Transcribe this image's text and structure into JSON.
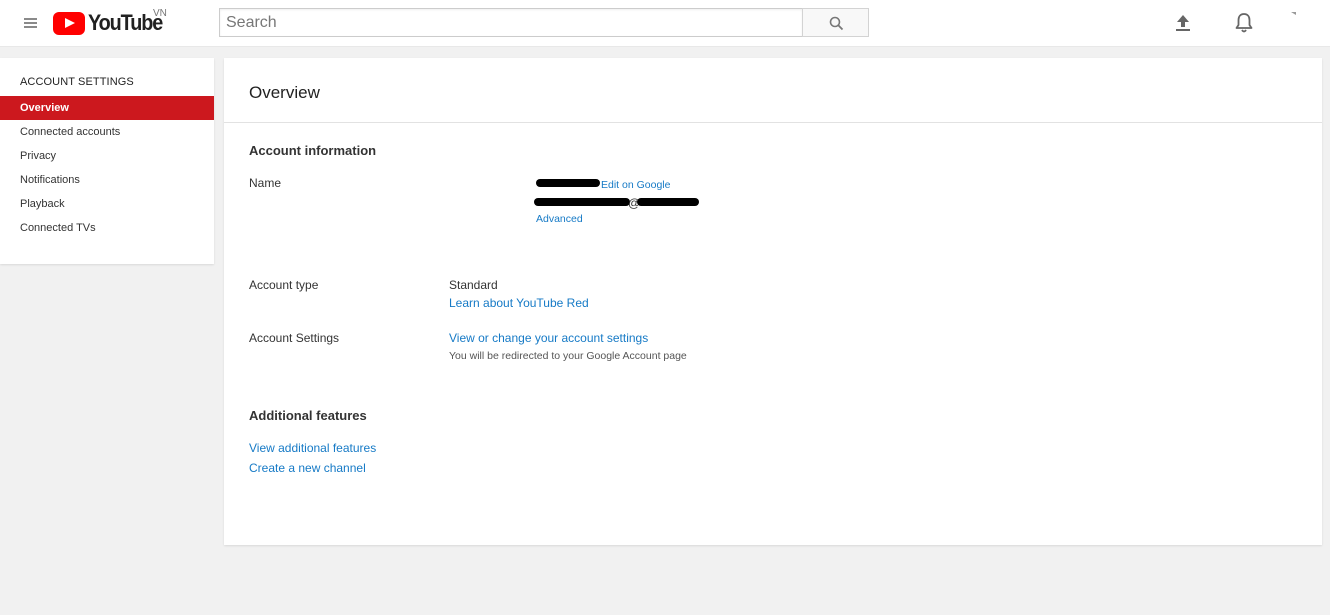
{
  "header": {
    "menu_icon": "hamburger-menu-icon",
    "logo_text": "YouTube",
    "logo_country": "VN",
    "search_placeholder": "Search",
    "search_icon": "search-icon",
    "upload_icon": "upload-icon",
    "notifications_icon": "bell-icon"
  },
  "sidebar": {
    "heading": "ACCOUNT SETTINGS",
    "items": [
      {
        "label": "Overview",
        "active": true
      },
      {
        "label": "Connected accounts",
        "active": false
      },
      {
        "label": "Privacy",
        "active": false
      },
      {
        "label": "Notifications",
        "active": false
      },
      {
        "label": "Playback",
        "active": false
      },
      {
        "label": "Connected TVs",
        "active": false
      }
    ]
  },
  "main": {
    "title": "Overview",
    "account_information": {
      "heading": "Account information",
      "name_label": "Name",
      "edit_link": "Edit on Google",
      "email_visible": "@",
      "advanced_link": "Advanced",
      "account_type_label": "Account type",
      "account_type_value": "Standard",
      "youtube_red_link": "Learn about YouTube Red",
      "account_settings_label": "Account Settings",
      "account_settings_link": "View or change your account settings",
      "account_settings_note": "You will be redirected to your Google Account page"
    },
    "additional_features": {
      "heading": "Additional features",
      "view_link": "View additional features",
      "create_channel_link": "Create a new channel"
    }
  },
  "colors": {
    "brand_red": "#ff0000",
    "active_sidebar": "#cc181e",
    "link_blue": "#167ac6",
    "page_background": "#f1f1f1"
  }
}
